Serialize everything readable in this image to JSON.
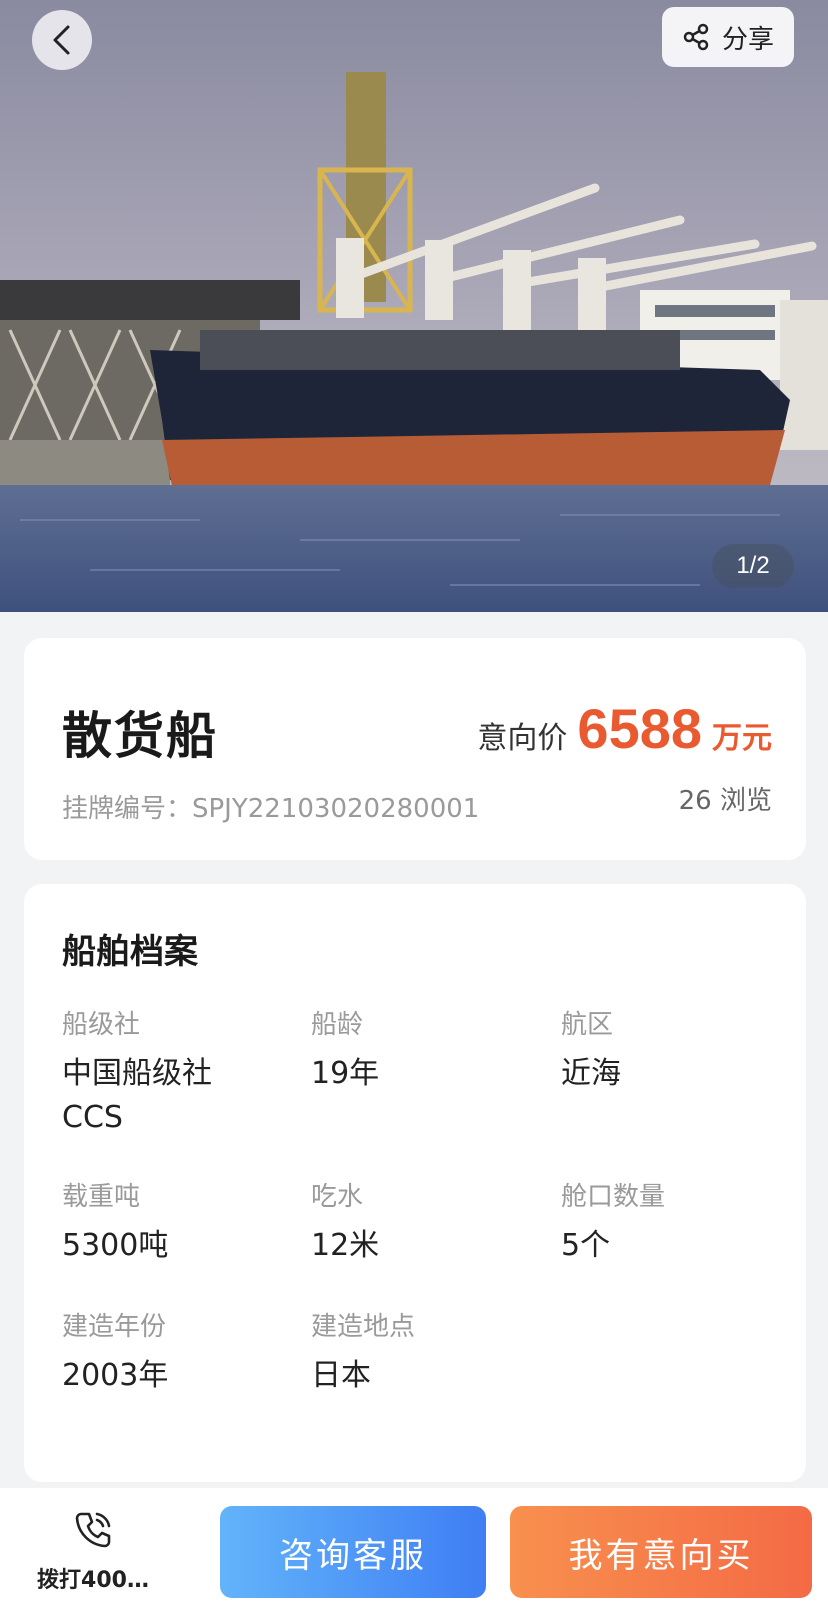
{
  "gallery": {
    "counter": "1/2",
    "image_description_icon": "ship-photo"
  },
  "header": {
    "back_icon": "chevron-left-icon",
    "share_icon": "share-icon",
    "share_label": "分享"
  },
  "listing": {
    "name": "散货船",
    "listing_no": "挂牌编号：SPJY22103020280001",
    "price_label": "意向价",
    "price_value": "6588",
    "price_unit": "万元",
    "views": "26 浏览"
  },
  "profile": {
    "title": "船舶档案",
    "items": [
      {
        "label": "船级社",
        "value": "中国船级社\nCCS"
      },
      {
        "label": "船龄",
        "value": "19年"
      },
      {
        "label": "航区",
        "value": "近海"
      },
      {
        "label": "载重吨",
        "value": "5300吨"
      },
      {
        "label": "吃水",
        "value": "12米"
      },
      {
        "label": "舱口数量",
        "value": "5个"
      },
      {
        "label": "建造年份",
        "value": "2003年"
      },
      {
        "label": "建造地点",
        "value": "日本"
      }
    ]
  },
  "bottom_bar": {
    "call_icon": "phone-icon",
    "call_label": "拨打400…",
    "consult_label": "咨询客服",
    "buy_label": "我有意向买"
  },
  "colors": {
    "accent_price": "#ea5a30",
    "consult_gradient": [
      "#62b4fa",
      "#3f7ef4"
    ],
    "buy_gradient": [
      "#f8904e",
      "#f46a45"
    ]
  }
}
